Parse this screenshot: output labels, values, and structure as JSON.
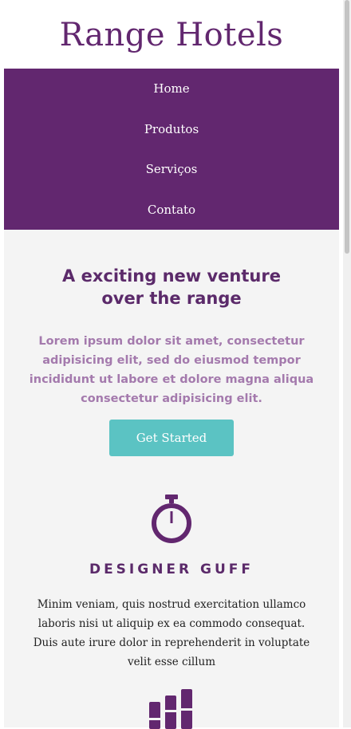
{
  "brand": {
    "name": "Range Hotels"
  },
  "nav": {
    "items": [
      {
        "label": "Home"
      },
      {
        "label": "Produtos"
      },
      {
        "label": "Serviços"
      },
      {
        "label": "Contato"
      }
    ]
  },
  "hero": {
    "title": "A exciting new venture over the range",
    "text": "Lorem ipsum dolor sit amet, consectetur adipisicing elit, sed do eiusmod tempor incididunt ut labore et dolore magna aliqua consectetur adipisicing elit.",
    "cta_label": "Get Started"
  },
  "features": [
    {
      "icon": "stopwatch-icon",
      "title": "DESIGNER GUFF",
      "text": "Minim veniam, quis nostrud exercitation ullamco laboris nisi ut aliquip ex ea commodo consequat. Duis aute irure dolor in reprehenderit in voluptate velit esse cillum"
    },
    {
      "icon": "bar-chart-icon"
    }
  ],
  "colors": {
    "brand_purple": "#62276f",
    "heading_purple": "#5b2a6a",
    "light_purple_text": "#a47aad",
    "teal_button": "#5bc3c3",
    "page_background": "#f4f4f4"
  }
}
